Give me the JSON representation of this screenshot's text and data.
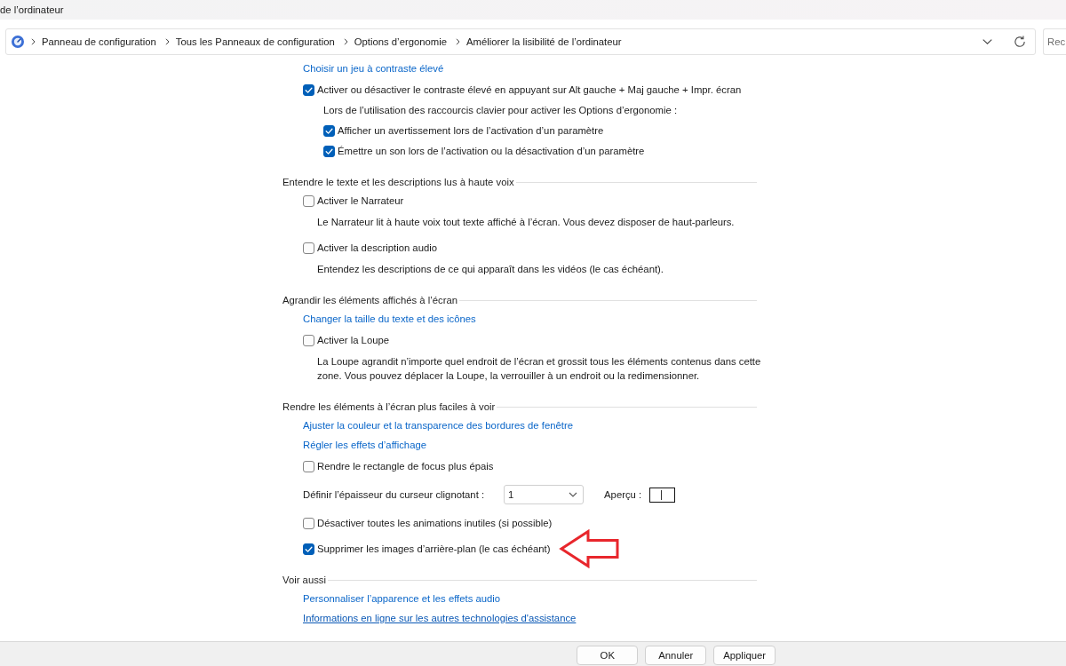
{
  "window": {
    "title": "de l’ordinateur"
  },
  "address_bar": {
    "breadcrumb": [
      {
        "label": "Panneau de configuration"
      },
      {
        "label": "Tous les Panneaux de configuration"
      },
      {
        "label": "Options d’ergonomie"
      },
      {
        "label": "Améliorer la lisibilité de l’ordinateur"
      }
    ],
    "search": {
      "placeholder": "Rec"
    }
  },
  "sections": [
    {
      "items": [
        {
          "kind": "link",
          "label": "Choisir un jeu à contraste élevé",
          "hovered": false
        },
        {
          "kind": "checkbox",
          "label": "Activer ou désactiver le contraste élevé en appuyant sur Alt gauche + Maj gauche + Impr. écran",
          "checked": true,
          "annotated": false,
          "children": [
            {
              "kind": "text",
              "text": "Lors de l’utilisation des raccourcis clavier pour activer les Options d’ergonomie :"
            },
            {
              "kind": "checkbox",
              "label": "Afficher un avertissement lors de l’activation d’un paramètre",
              "checked": true,
              "annotated": false
            },
            {
              "kind": "checkbox",
              "label": "Émettre un son lors de l’activation ou la désactivation d’un paramètre",
              "checked": true,
              "annotated": false
            }
          ]
        }
      ]
    },
    {
      "heading": "Entendre le texte et les descriptions lus à haute voix",
      "items": [
        {
          "kind": "checkbox",
          "label": "Activer le Narrateur",
          "checked": false,
          "annotated": false,
          "description": "Le Narrateur lit à haute voix tout texte affiché à l’écran. Vous devez disposer de haut-parleurs."
        },
        {
          "kind": "checkbox",
          "label": "Activer la description audio",
          "checked": false,
          "annotated": false,
          "description": "Entendez les descriptions de ce qui apparaît dans les vidéos (le cas échéant)."
        }
      ]
    },
    {
      "heading": "Agrandir les éléments affichés à l’écran",
      "items": [
        {
          "kind": "link",
          "label": "Changer la taille du texte et des icônes",
          "hovered": false
        },
        {
          "kind": "checkbox",
          "label": "Activer la Loupe",
          "checked": false,
          "annotated": false,
          "description": "La Loupe agrandit n’importe quel endroit de l’écran et grossit tous les éléments contenus dans cette zone. Vous pouvez déplacer la Loupe, la verrouiller à un endroit ou la redimensionner."
        }
      ]
    },
    {
      "heading": "Rendre les éléments à l’écran plus faciles à voir",
      "items": [
        {
          "kind": "link",
          "label": "Ajuster la couleur et la transparence des bordures de fenêtre",
          "hovered": false
        },
        {
          "kind": "link",
          "label": "Régler les effets d’affichage",
          "hovered": false
        },
        {
          "kind": "checkbox",
          "label": "Rendre le rectangle de focus plus épais",
          "checked": false,
          "annotated": false
        },
        {
          "kind": "select",
          "label": "Définir l’épaisseur du curseur clignotant :",
          "value": "1",
          "preview_label": "Aperçu :"
        },
        {
          "kind": "checkbox",
          "label": "Désactiver toutes les animations inutiles (si possible)",
          "checked": false,
          "annotated": false
        },
        {
          "kind": "checkbox",
          "label": "Supprimer les images d’arrière-plan (le cas échéant)",
          "checked": true,
          "annotated": true
        }
      ]
    },
    {
      "heading": "Voir aussi",
      "items": [
        {
          "kind": "link",
          "label": "Personnaliser l’apparence et les effets audio",
          "hovered": false
        },
        {
          "kind": "link",
          "label": "Informations en ligne sur les autres technologies d'assistance",
          "hovered": true
        }
      ]
    }
  ],
  "buttons": [
    {
      "label": "OK"
    },
    {
      "label": "Annuler"
    },
    {
      "label": "Appliquer"
    }
  ]
}
